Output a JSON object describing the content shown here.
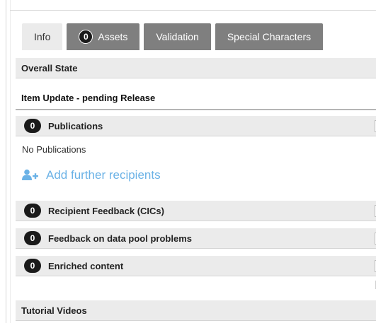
{
  "tabs": [
    {
      "label": "Info",
      "active": true
    },
    {
      "label": "Assets",
      "badge": "0"
    },
    {
      "label": "Validation"
    },
    {
      "label": "Special Characters"
    }
  ],
  "overall_state": {
    "title": "Overall State",
    "value": "Item Update - pending Release"
  },
  "publications": {
    "count": "0",
    "title": "Publications",
    "empty_text": "No Publications",
    "add_link": "Add further recipients",
    "add_icon": "add-user-icon"
  },
  "sections": [
    {
      "count": "0",
      "title": "Recipient Feedback (CICs)"
    },
    {
      "count": "0",
      "title": "Feedback on data pool problems"
    },
    {
      "count": "0",
      "title": "Enriched content"
    }
  ],
  "tutorial": {
    "title": "Tutorial Videos"
  },
  "colors": {
    "link": "#6bb2e6",
    "tab_inactive": "#7f7f7f",
    "tab_active": "#ebebeb",
    "header_bg": "#ebebeb"
  }
}
